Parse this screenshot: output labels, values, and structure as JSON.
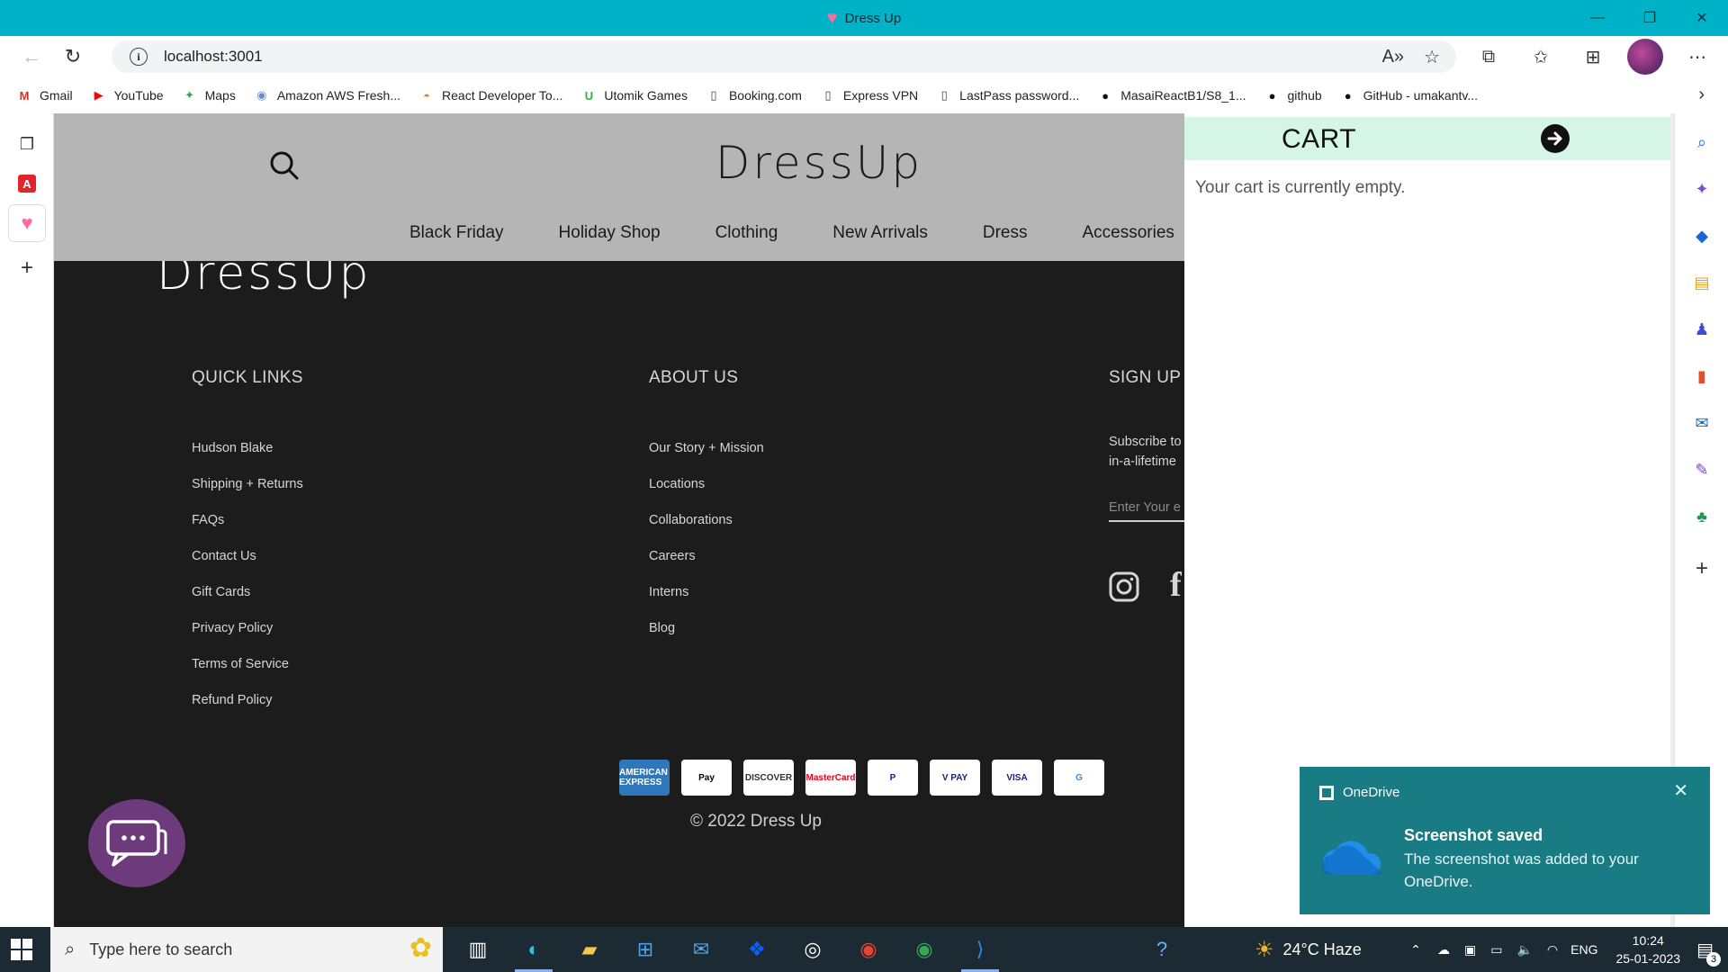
{
  "window": {
    "title": "Dress Up",
    "controls": [
      "—",
      "❐",
      "✕"
    ]
  },
  "browser": {
    "url": "localhost:3001",
    "bookmarks": [
      {
        "label": "Gmail",
        "icon": "gmail-icon",
        "glyph": "M",
        "color": "#d93025"
      },
      {
        "label": "YouTube",
        "icon": "youtube-icon",
        "glyph": "▶",
        "color": "#ff0000"
      },
      {
        "label": "Maps",
        "icon": "maps-icon",
        "glyph": "✦",
        "color": "#34a853"
      },
      {
        "label": "Amazon AWS Fresh...",
        "icon": "aws-icon",
        "glyph": "◉",
        "color": "#6a8fc8"
      },
      {
        "label": "React Developer To...",
        "icon": "rainbow-icon",
        "glyph": "◓",
        "color": "#e0822d"
      },
      {
        "label": "Utomik Games",
        "icon": "utomik-icon",
        "glyph": "U",
        "color": "#2ab24a"
      },
      {
        "label": "Booking.com",
        "icon": "page-icon",
        "glyph": "▯",
        "color": "#444"
      },
      {
        "label": "Express VPN",
        "icon": "page-icon",
        "glyph": "▯",
        "color": "#444"
      },
      {
        "label": "LastPass password...",
        "icon": "page-icon",
        "glyph": "▯",
        "color": "#444"
      },
      {
        "label": "MasaiReactB1/S8_1...",
        "icon": "github-icon",
        "glyph": "●",
        "color": "#111"
      },
      {
        "label": "github",
        "icon": "github-icon",
        "glyph": "●",
        "color": "#111"
      },
      {
        "label": "GitHub - umakantv...",
        "icon": "github-icon",
        "glyph": "●",
        "color": "#111"
      }
    ]
  },
  "site": {
    "logo": "DressUp",
    "menu": [
      "Black Friday",
      "Holiday Shop",
      "Clothing",
      "New Arrivals",
      "Dress",
      "Accessories"
    ],
    "ghost_logo": "DressUp",
    "footer": {
      "quick_links": {
        "title": "QUICK LINKS",
        "items": [
          "Hudson Blake",
          "Shipping + Returns",
          "FAQs",
          "Contact Us",
          "Gift Cards",
          "Privacy Policy",
          "Terms of Service",
          "Refund Policy"
        ]
      },
      "about": {
        "title": "ABOUT US",
        "items": [
          "Our Story + Mission",
          "Locations",
          "Collaborations",
          "Careers",
          "Interns",
          "Blog"
        ]
      },
      "signup": {
        "title": "SIGN UP",
        "text_line1": "Subscribe to",
        "text_line2": "in-a-lifetime",
        "placeholder": "Enter Your e"
      },
      "facebook_glyph": "f",
      "payments": [
        {
          "label": "AMERICAN EXPRESS",
          "bg": "#2e77bb",
          "fg": "#ffffff"
        },
        {
          "label": "Pay",
          "bg": "#ffffff",
          "fg": "#000000"
        },
        {
          "label": "DISCOVER",
          "bg": "#ffffff",
          "fg": "#333333"
        },
        {
          "label": "MasterCard",
          "bg": "#ffffff",
          "fg": "#eb001b"
        },
        {
          "label": "P",
          "bg": "#ffffff",
          "fg": "#003087"
        },
        {
          "label": "V PAY",
          "bg": "#ffffff",
          "fg": "#1a1f71"
        },
        {
          "label": "VISA",
          "bg": "#ffffff",
          "fg": "#1a1f71"
        },
        {
          "label": "G",
          "bg": "#ffffff",
          "fg": "#4285f4"
        }
      ],
      "copyright": "© 2022 Dress Up"
    }
  },
  "cart": {
    "title": "CART",
    "empty_text": "Your cart is currently empty."
  },
  "toast": {
    "app": "OneDrive",
    "title": "Screenshot saved",
    "message": "The screenshot was added to your OneDrive."
  },
  "taskbar": {
    "search_placeholder": "Type here to search",
    "weather": "24°C  Haze",
    "language": "ENG",
    "time": "10:24",
    "date": "25-01-2023",
    "notification_count": "3"
  },
  "colors": {
    "titlebar": "#00b2c8",
    "site_header": "#b5b5b5",
    "footer_bg": "#1c1c1c",
    "cart_header": "#d5f6e6",
    "toast_bg": "#197b83",
    "chat_button": "#6d3a7b"
  }
}
